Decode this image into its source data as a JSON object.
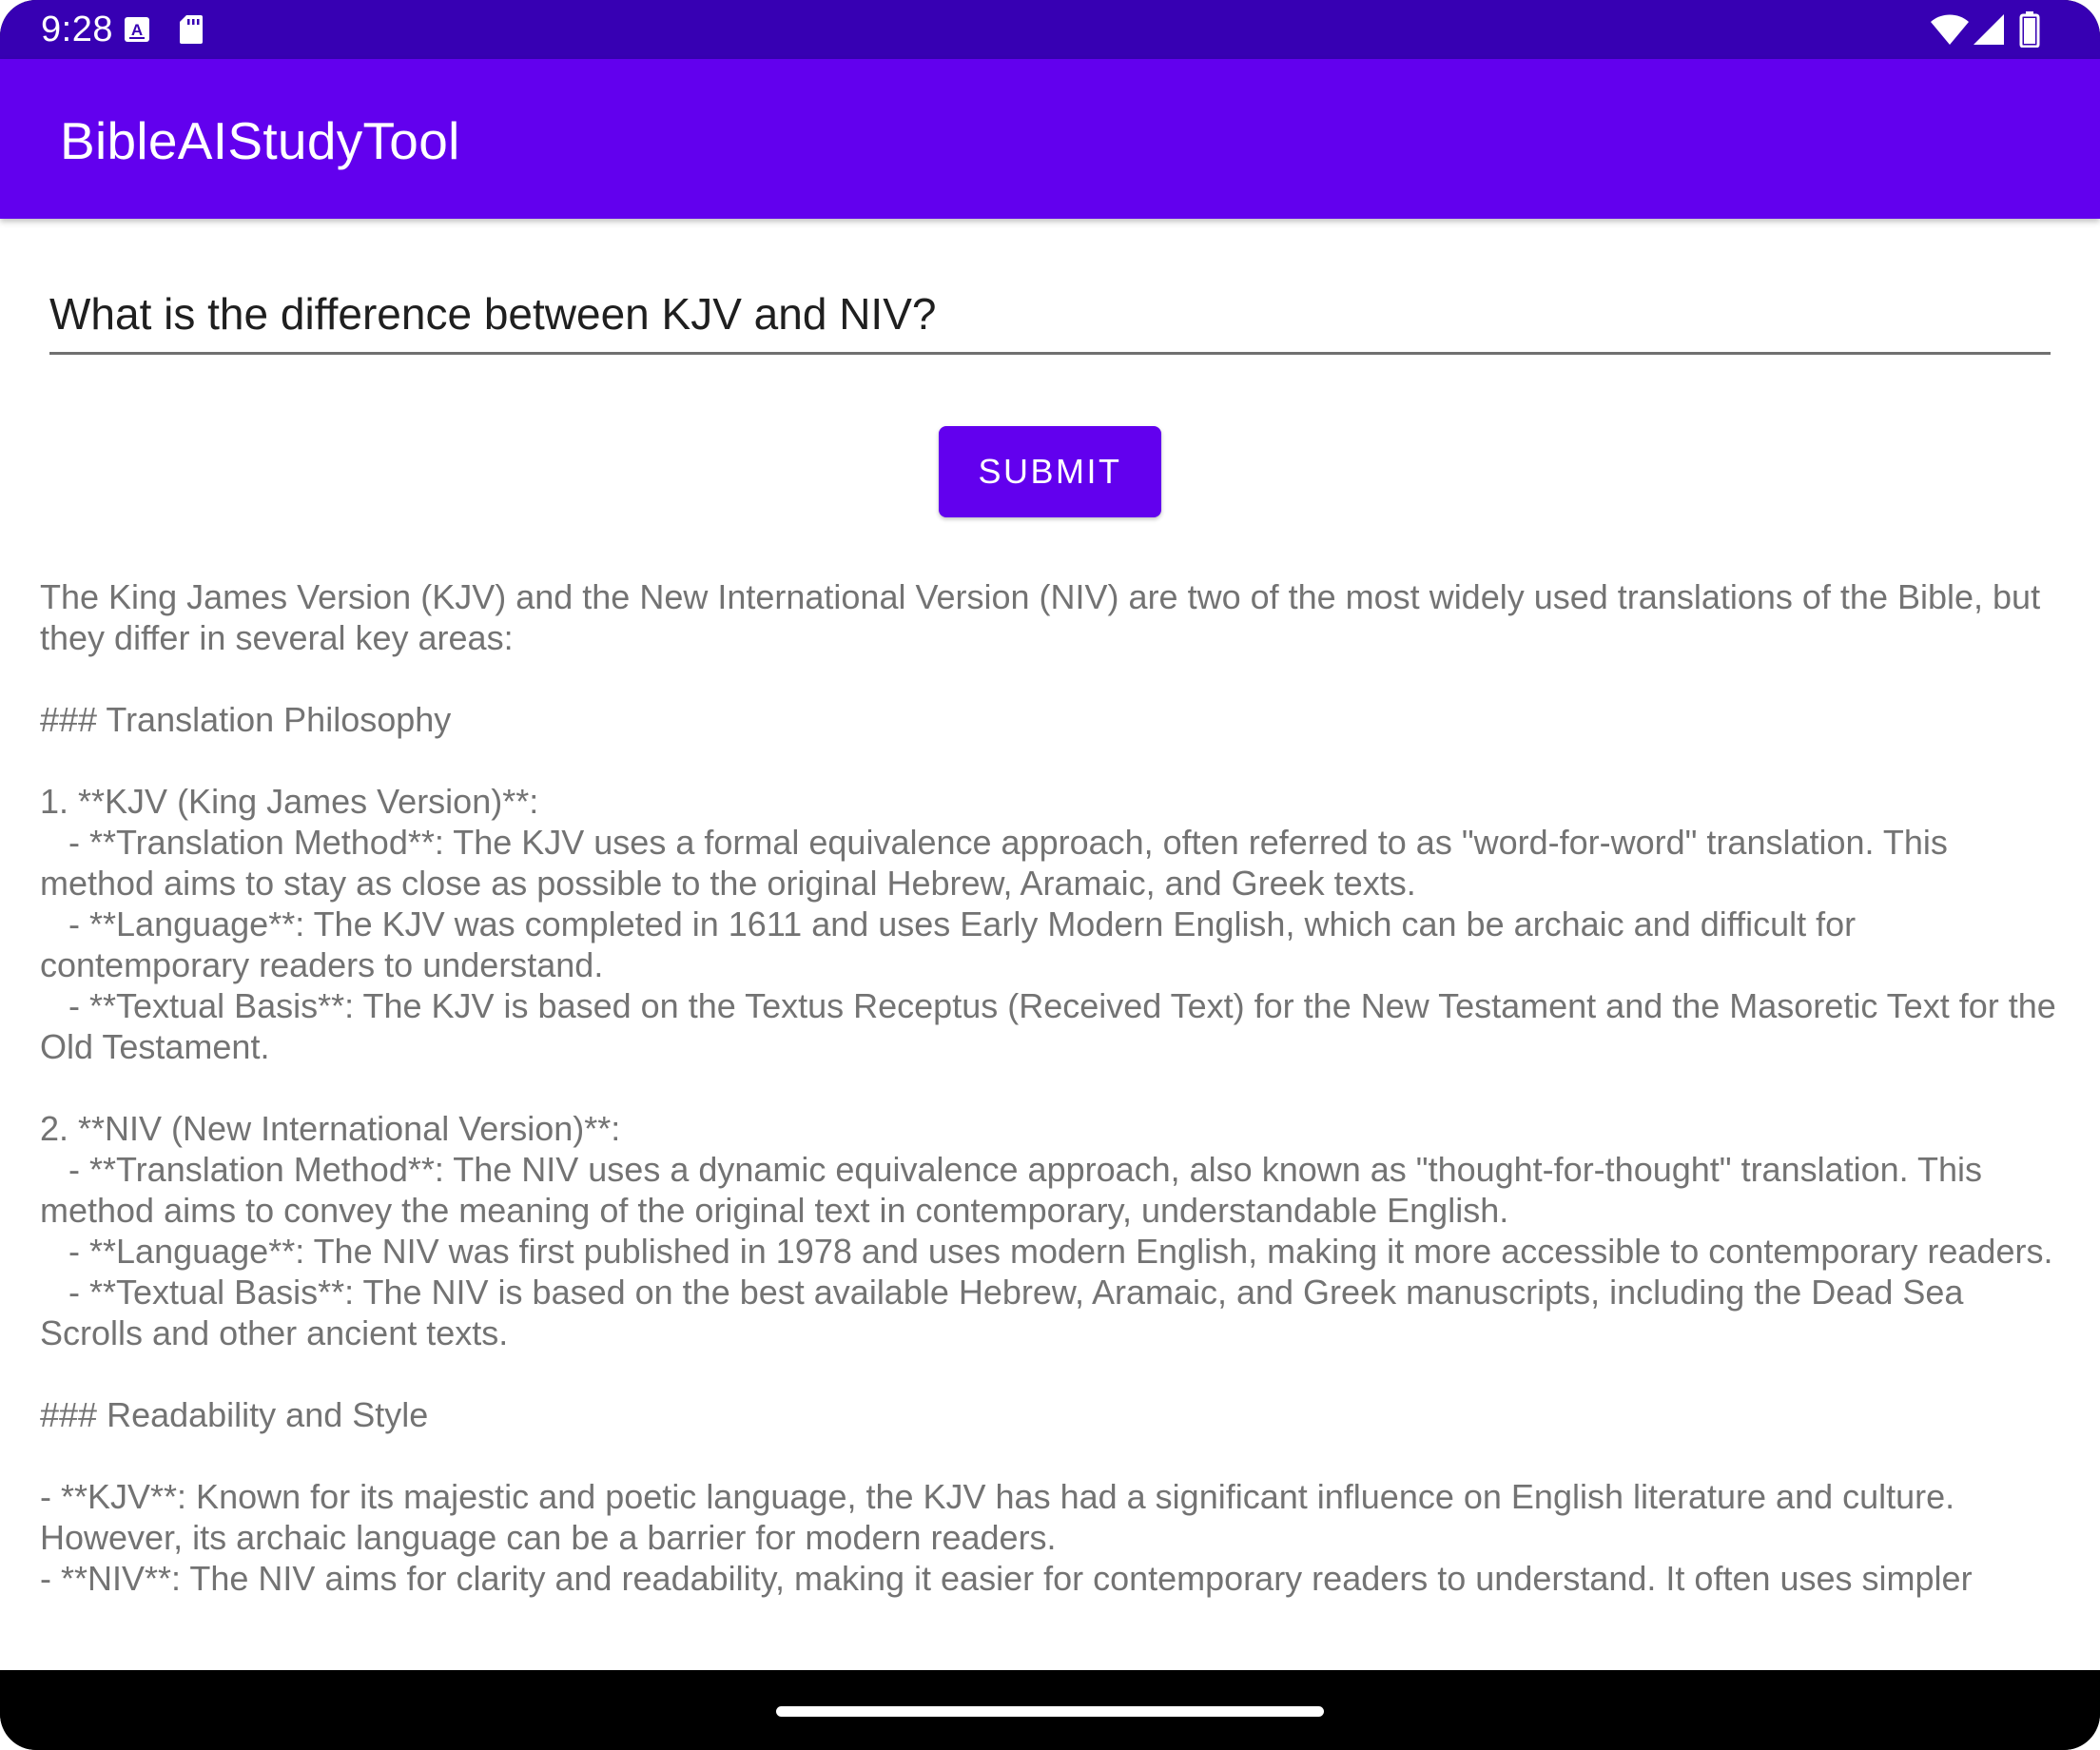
{
  "status_bar": {
    "time": "9:28",
    "icons": [
      "keyboard-a-icon",
      "sd-card-icon",
      "wifi-icon",
      "signal-icon",
      "battery-icon"
    ],
    "color": "#3700b3"
  },
  "app_bar": {
    "title": "BibleAIStudyTool",
    "color": "#6200ee"
  },
  "form": {
    "query_value": "What is the difference between KJV and NIV?",
    "submit_label": "SUBMIT"
  },
  "response": {
    "text": "The King James Version (KJV) and the New International Version (NIV) are two of the most widely used translations of the Bible, but they differ in several key areas:\n\n### Translation Philosophy\n\n1. **KJV (King James Version)**:\n   - **Translation Method**: The KJV uses a formal equivalence approach, often referred to as \"word-for-word\" translation. This method aims to stay as close as possible to the original Hebrew, Aramaic, and Greek texts.\n   - **Language**: The KJV was completed in 1611 and uses Early Modern English, which can be archaic and difficult for contemporary readers to understand.\n   - **Textual Basis**: The KJV is based on the Textus Receptus (Received Text) for the New Testament and the Masoretic Text for the Old Testament.\n\n2. **NIV (New International Version)**:\n   - **Translation Method**: The NIV uses a dynamic equivalence approach, also known as \"thought-for-thought\" translation. This method aims to convey the meaning of the original text in contemporary, understandable English.\n   - **Language**: The NIV was first published in 1978 and uses modern English, making it more accessible to contemporary readers.\n   - **Textual Basis**: The NIV is based on the best available Hebrew, Aramaic, and Greek manuscripts, including the Dead Sea Scrolls and other ancient texts.\n\n### Readability and Style\n\n- **KJV**: Known for its majestic and poetic language, the KJV has had a significant influence on English literature and culture. However, its archaic language can be a barrier for modern readers.\n- **NIV**: The NIV aims for clarity and readability, making it easier for contemporary readers to understand. It often uses simpler"
  },
  "nav_bar": {
    "handle": "home-gesture-handle"
  }
}
